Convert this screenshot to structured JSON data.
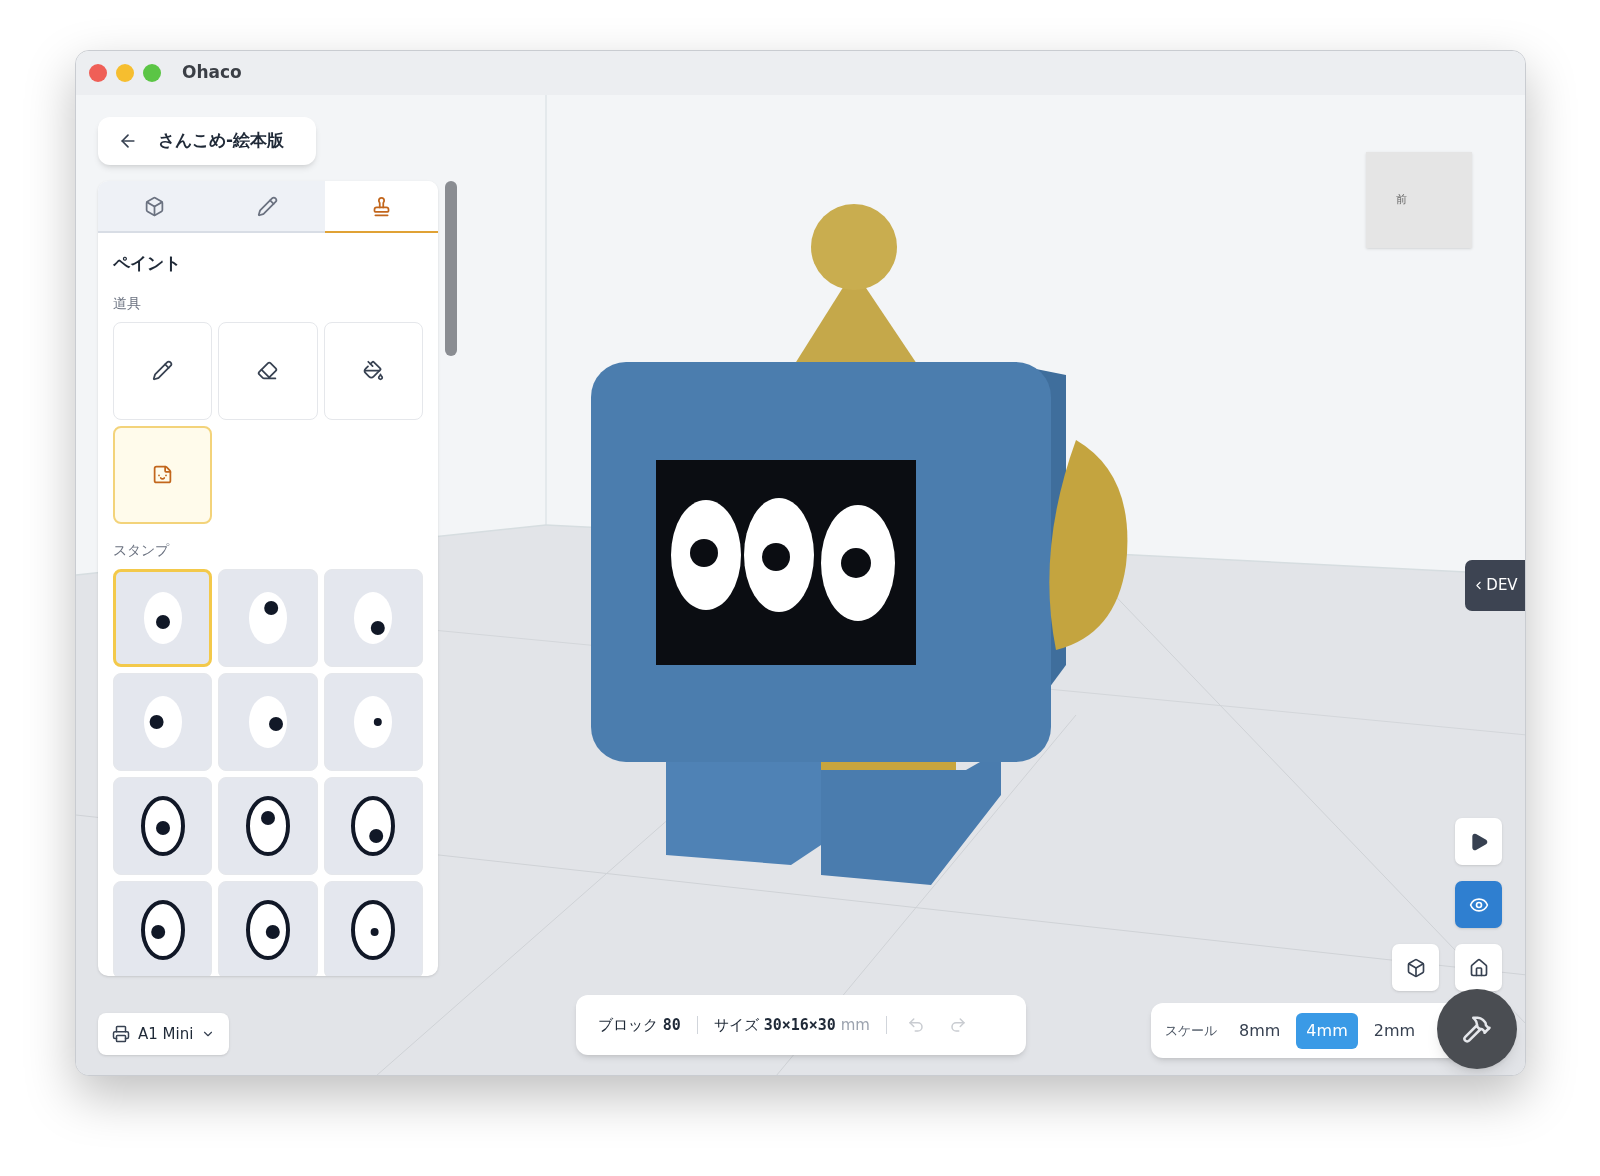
{
  "window": {
    "title": "Ohaco"
  },
  "project": {
    "title": "さんこめ-絵本版"
  },
  "panel_tabs": [
    {
      "kind": "model",
      "selected": false
    },
    {
      "kind": "draw",
      "selected": false
    },
    {
      "kind": "stamp",
      "selected": true
    }
  ],
  "paint": {
    "heading": "ペイント",
    "tools_label": "道具",
    "tools": [
      {
        "kind": "pencil",
        "selected": false
      },
      {
        "kind": "eraser",
        "selected": false
      },
      {
        "kind": "bucket",
        "selected": false
      },
      {
        "kind": "sticker",
        "selected": true
      }
    ],
    "stamps_label": "スタンプ",
    "stamps": [
      {
        "kind": "dot",
        "selected": true
      },
      {
        "kind": "dot",
        "selected": false
      },
      {
        "kind": "dot",
        "selected": false
      },
      {
        "kind": "dot",
        "selected": false
      },
      {
        "kind": "dot",
        "selected": false
      },
      {
        "kind": "dot",
        "selected": false
      },
      {
        "kind": "ring",
        "selected": false
      },
      {
        "kind": "ring",
        "selected": false
      },
      {
        "kind": "ring",
        "selected": false
      },
      {
        "kind": "ring",
        "selected": false
      },
      {
        "kind": "ring",
        "selected": false
      },
      {
        "kind": "ring",
        "selected": false
      }
    ]
  },
  "printer": {
    "label": "A1 Mini"
  },
  "status": {
    "blocks_label": "ブロック",
    "blocks": "80",
    "size_label": "サイズ",
    "size": "30×16×30",
    "unit": "mm",
    "undo_disabled": true,
    "redo_disabled": true
  },
  "view_cube": {
    "face": "前"
  },
  "dev_tab": {
    "label": "DEV"
  },
  "view_buttons": [
    {
      "kind": "play",
      "selected": false
    },
    {
      "kind": "eye",
      "selected": true
    },
    {
      "kind": "cube",
      "selected": false
    },
    {
      "kind": "home",
      "selected": false
    }
  ],
  "scale": {
    "label": "スケール",
    "options": [
      {
        "label": "8mm",
        "selected": false
      },
      {
        "label": "4mm",
        "selected": true
      },
      {
        "label": "2mm",
        "selected": false
      }
    ]
  }
}
